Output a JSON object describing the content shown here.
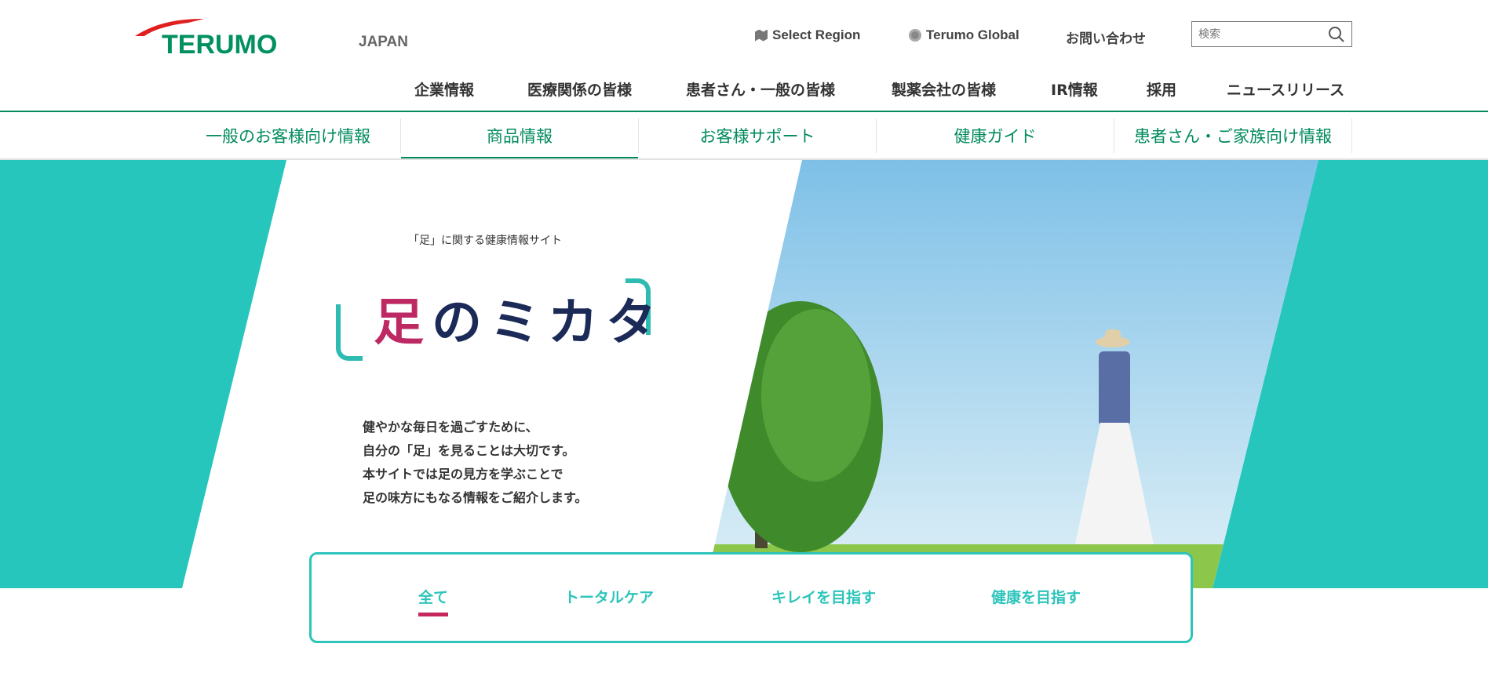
{
  "header": {
    "logo_text": "TERUMO",
    "region": "JAPAN",
    "links": [
      {
        "label": "Select Region",
        "icon": "map-icon"
      },
      {
        "label": "Terumo Global",
        "icon": "globe-icon"
      },
      {
        "label": "お問い合わせ"
      }
    ],
    "search_placeholder": "検索"
  },
  "main_nav": [
    "企業情報",
    "医療関係の皆様",
    "患者さん・一般の皆様",
    "製薬会社の皆様",
    "IR情報",
    "採用",
    "ニュースリリース"
  ],
  "sub_nav": {
    "items": [
      "一般のお客様向け情報",
      "商品情報",
      "お客様サポート",
      "健康ガイド",
      "患者さん・ご家族向け情報"
    ],
    "active": 1
  },
  "hero": {
    "subtitle": "「足」に関する健康情報サイト",
    "title_accent": "足",
    "title_rest": "のミカタ",
    "body": [
      "健やかな毎日を過ごすために、",
      "自分の「足」を見ることは大切です。",
      "本サイトでは足の見方を学ぶことで",
      "足の味方にもなる情報をご紹介します。"
    ]
  },
  "filter": {
    "tabs": [
      "全て",
      "トータルケア",
      "キレイを目指す",
      "健康を目指す"
    ],
    "active": 0
  },
  "colors": {
    "brand_green": "#008a5e",
    "teal": "#26c6bc",
    "accent": "#c5275f",
    "navy": "#1b2a57"
  }
}
